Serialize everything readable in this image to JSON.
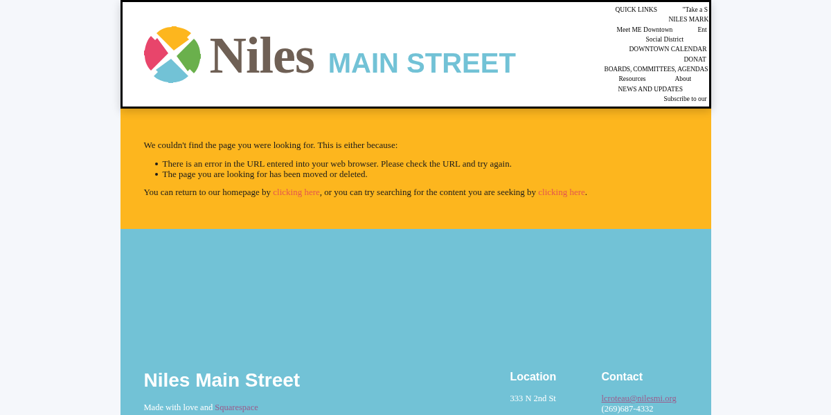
{
  "header": {
    "logo": {
      "wordmark": "Niles",
      "tagline": "MAIN STREET"
    },
    "nav_rows": [
      [
        "QUICK LINKS",
        "\"Take a S"
      ],
      [
        "NILES MARK"
      ],
      [
        "Meet ME Downtown",
        "Ent"
      ],
      [
        "Social District"
      ],
      [
        "DOWNTOWN CALENDAR"
      ],
      [
        "DONAT"
      ],
      [
        "BOARDS, COMMITTEES, AGENDAS"
      ],
      [
        "Resources",
        "About"
      ],
      [
        "NEWS AND UPDATES"
      ],
      [
        "Subscribe to our"
      ]
    ]
  },
  "error_notice": {
    "intro": "We couldn't find the page you were looking for. This is either because:",
    "reasons": [
      "There is an error in the URL entered into your web browser. Please check the URL and try again.",
      "The page you are looking for has been moved or deleted."
    ],
    "closing": [
      {
        "kind": "text",
        "text": "You can return to our homepage by "
      },
      {
        "kind": "link",
        "text": "clicking here"
      },
      {
        "kind": "text",
        "text": ", or you can try searching for the content you are seeking by "
      },
      {
        "kind": "link",
        "text": "clicking here"
      },
      {
        "kind": "text",
        "text": "."
      }
    ]
  },
  "footer": {
    "title": "Niles Main Street",
    "credit": {
      "text": "Made with love and ",
      "link": "Squarespace"
    },
    "columns": [
      {
        "heading": "Location",
        "lines": [
          {
            "kind": "text",
            "text": "333 N 2nd St"
          }
        ]
      },
      {
        "heading": "Contact",
        "lines": [
          {
            "kind": "link",
            "text": "lcroteau@nilesmi.org"
          },
          {
            "kind": "text",
            "text": "(269)687-4332"
          }
        ]
      }
    ]
  }
}
